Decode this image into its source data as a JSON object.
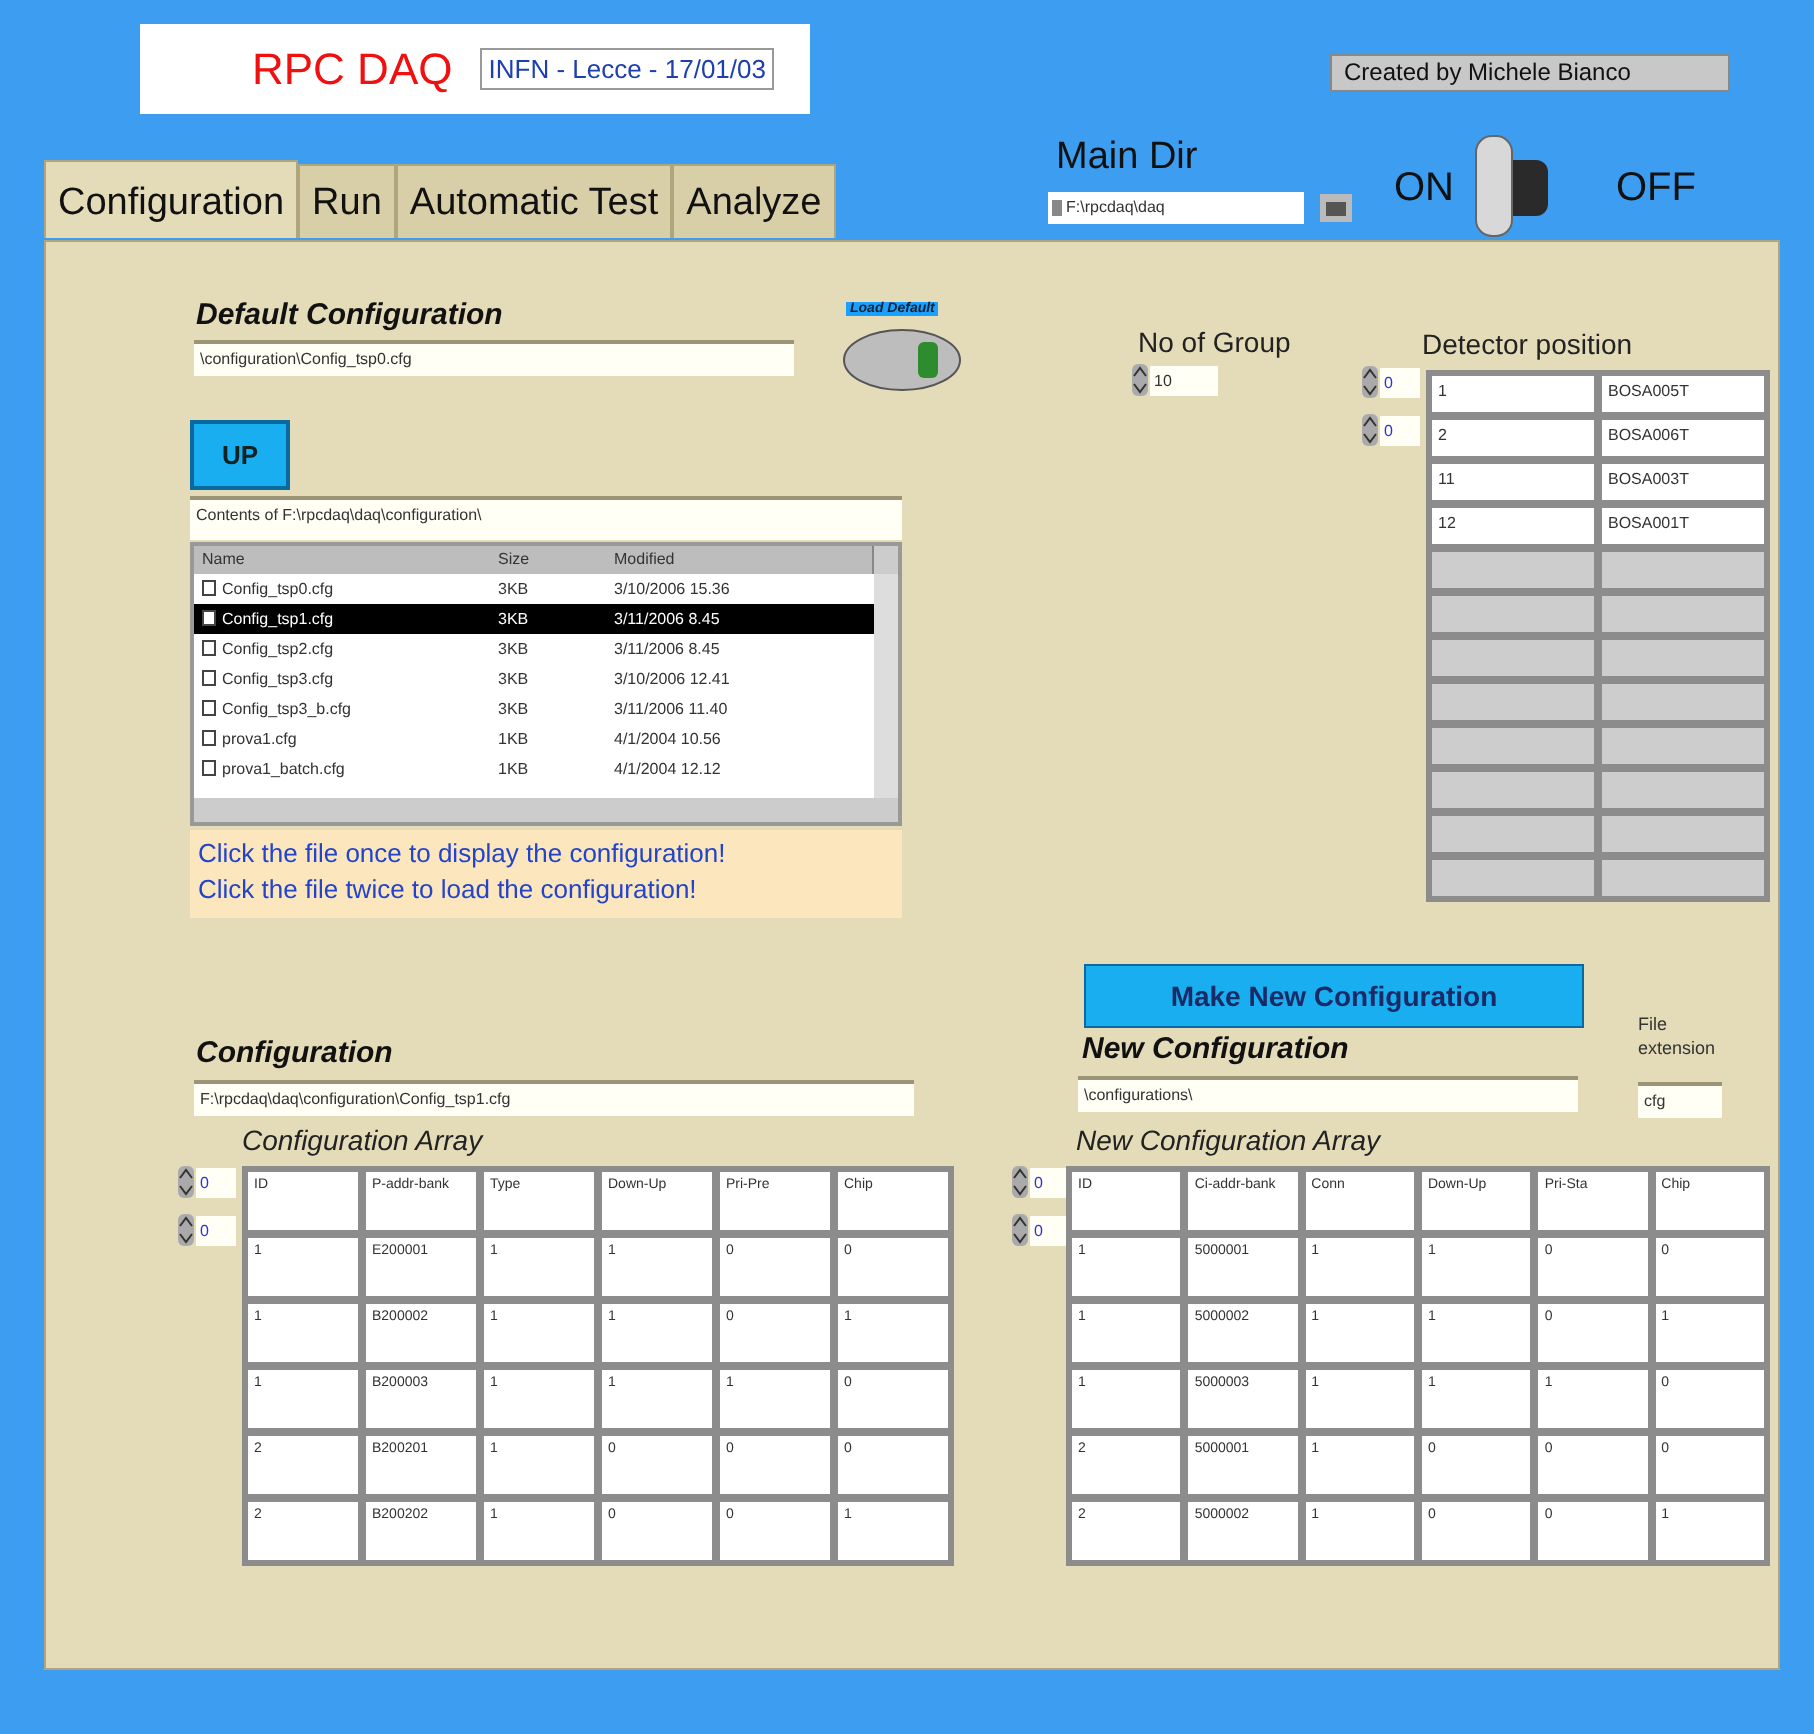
{
  "header": {
    "title": "RPC DAQ",
    "subtitle": "INFN - Lecce - 17/01/03",
    "author": "Created by Michele Bianco"
  },
  "tabs": [
    {
      "label": "Configuration",
      "selected": true
    },
    {
      "label": "Run",
      "selected": false
    },
    {
      "label": "Automatic Test",
      "selected": false
    },
    {
      "label": "Analyze",
      "selected": false
    }
  ],
  "main_dir": {
    "label": "Main Dir",
    "value": "F:\\rpcdaq\\daq"
  },
  "power_switch": {
    "on_label": "ON",
    "off_label": "OFF",
    "on": true
  },
  "default_configuration": {
    "title": "Default Configuration",
    "path": "\\configuration\\Config_tsp0.cfg",
    "load_button": "Load Default"
  },
  "file_browser": {
    "up_button": "UP",
    "caption": "Contents of F:\\rpcdaq\\daq\\configuration\\",
    "columns": [
      "Name",
      "Size",
      "Modified"
    ],
    "rows": [
      {
        "cells": [
          "Config_tsp0.cfg",
          "3KB",
          "3/10/2006 15.36"
        ],
        "selected": false
      },
      {
        "cells": [
          "Config_tsp1.cfg",
          "3KB",
          "3/11/2006 8.45"
        ],
        "selected": true
      },
      {
        "cells": [
          "Config_tsp2.cfg",
          "3KB",
          "3/11/2006 8.45"
        ],
        "selected": false
      },
      {
        "cells": [
          "Config_tsp3.cfg",
          "3KB",
          "3/10/2006 12.41"
        ],
        "selected": false
      },
      {
        "cells": [
          "Config_tsp3_b.cfg",
          "3KB",
          "3/11/2006 11.40"
        ],
        "selected": false
      },
      {
        "cells": [
          "prova1.cfg",
          "1KB",
          "4/1/2004 10.56"
        ],
        "selected": false
      },
      {
        "cells": [
          "prova1_batch.cfg",
          "1KB",
          "4/1/2004 12.12"
        ],
        "selected": false
      }
    ],
    "hints": [
      "Click the file once to display the configuration!",
      "Click the file twice to load the configuration!"
    ]
  },
  "no_of_group": {
    "label": "No of Group",
    "value": "10"
  },
  "detector_position": {
    "label": "Detector position",
    "indices": [
      "0",
      "0"
    ],
    "rows": [
      {
        "cells": [
          "1",
          "BOSA005T"
        ],
        "disabled": false
      },
      {
        "cells": [
          "2",
          "BOSA006T"
        ],
        "disabled": false
      },
      {
        "cells": [
          "11",
          "BOSA003T"
        ],
        "disabled": false
      },
      {
        "cells": [
          "12",
          "BOSA001T"
        ],
        "disabled": false
      },
      {
        "disabled": true
      },
      {
        "disabled": true
      },
      {
        "disabled": true
      },
      {
        "disabled": true
      },
      {
        "disabled": true
      },
      {
        "disabled": true
      },
      {
        "disabled": true
      },
      {
        "disabled": true
      }
    ]
  },
  "configuration": {
    "title": "Configuration",
    "path": "F:\\rpcdaq\\daq\\configuration\\Config_tsp1.cfg",
    "array_title": "Configuration Array",
    "indices": [
      "0",
      "0"
    ],
    "rows": [
      [
        "ID",
        "P-addr-bank",
        "Type",
        "Down-Up",
        "Pri-Pre",
        "Chip"
      ],
      [
        "1",
        "E200001",
        "1",
        "1",
        "0",
        "0"
      ],
      [
        "1",
        "B200002",
        "1",
        "1",
        "0",
        "1"
      ],
      [
        "1",
        "B200003",
        "1",
        "1",
        "1",
        "0"
      ],
      [
        "2",
        "B200201",
        "1",
        "0",
        "0",
        "0"
      ],
      [
        "2",
        "B200202",
        "1",
        "0",
        "0",
        "1"
      ]
    ]
  },
  "new_configuration": {
    "make_button": "Make New Configuration",
    "title": "New Configuration",
    "path": "\\configurations\\",
    "extension_label": "File extension",
    "extension": "cfg",
    "array_title": "New Configuration Array",
    "indices": [
      "0",
      "0"
    ],
    "rows": [
      [
        "ID",
        "Ci-addr-bank",
        "Conn",
        "Down-Up",
        "Pri-Sta",
        "Chip"
      ],
      [
        "1",
        "5000001",
        "1",
        "1",
        "0",
        "0"
      ],
      [
        "1",
        "5000002",
        "1",
        "1",
        "0",
        "1"
      ],
      [
        "1",
        "5000003",
        "1",
        "1",
        "1",
        "0"
      ],
      [
        "2",
        "5000001",
        "1",
        "0",
        "0",
        "0"
      ],
      [
        "2",
        "5000002",
        "1",
        "0",
        "0",
        "1"
      ]
    ]
  }
}
